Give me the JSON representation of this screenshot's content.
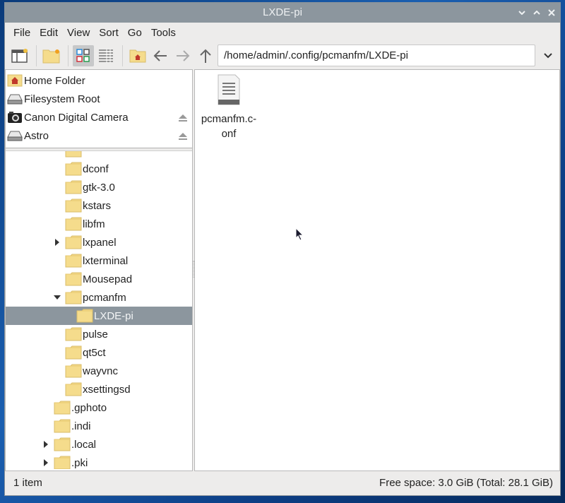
{
  "window": {
    "title": "LXDE-pi",
    "controls": [
      "minimize",
      "maximize",
      "close"
    ]
  },
  "menubar": {
    "items": [
      "File",
      "Edit",
      "View",
      "Sort",
      "Go",
      "Tools"
    ]
  },
  "toolbar": {
    "buttons": [
      {
        "name": "new-window",
        "icon": "new-window-icon"
      },
      {
        "name": "new-folder",
        "icon": "new-folder-icon"
      },
      {
        "name": "icon-view",
        "icon": "icon-view-icon",
        "active": true
      },
      {
        "name": "list-view",
        "icon": "list-view-icon"
      },
      {
        "name": "home",
        "icon": "home-folder-icon"
      },
      {
        "name": "back",
        "icon": "arrow-left-icon"
      },
      {
        "name": "forward",
        "icon": "arrow-right-icon",
        "disabled": true
      },
      {
        "name": "up",
        "icon": "arrow-up-icon"
      }
    ],
    "path": "/home/admin/.config/pcmanfm/LXDE-pi"
  },
  "places": [
    {
      "label": "Home Folder",
      "icon": "home-folder-icon",
      "eject": false
    },
    {
      "label": "Filesystem Root",
      "icon": "drive-icon",
      "eject": false
    },
    {
      "label": "Canon Digital Camera",
      "icon": "camera-icon",
      "eject": true
    },
    {
      "label": "Astro",
      "icon": "drive-icon",
      "eject": true
    }
  ],
  "tree": [
    {
      "label": "",
      "depth": 2,
      "expander": "none",
      "partial": true
    },
    {
      "label": "dconf",
      "depth": 2,
      "expander": "none"
    },
    {
      "label": "gtk-3.0",
      "depth": 2,
      "expander": "none"
    },
    {
      "label": "kstars",
      "depth": 2,
      "expander": "none"
    },
    {
      "label": "libfm",
      "depth": 2,
      "expander": "none"
    },
    {
      "label": "lxpanel",
      "depth": 2,
      "expander": "collapsed"
    },
    {
      "label": "lxterminal",
      "depth": 2,
      "expander": "none"
    },
    {
      "label": "Mousepad",
      "depth": 2,
      "expander": "none"
    },
    {
      "label": "pcmanfm",
      "depth": 2,
      "expander": "expanded"
    },
    {
      "label": "LXDE-pi",
      "depth": 3,
      "expander": "none",
      "selected": true
    },
    {
      "label": "pulse",
      "depth": 2,
      "expander": "none"
    },
    {
      "label": "qt5ct",
      "depth": 2,
      "expander": "none"
    },
    {
      "label": "wayvnc",
      "depth": 2,
      "expander": "none"
    },
    {
      "label": "xsettingsd",
      "depth": 2,
      "expander": "none"
    },
    {
      "label": ".gphoto",
      "depth": 1,
      "expander": "none"
    },
    {
      "label": ".indi",
      "depth": 1,
      "expander": "none"
    },
    {
      "label": ".local",
      "depth": 1,
      "expander": "collapsed"
    },
    {
      "label": ".pki",
      "depth": 1,
      "expander": "collapsed"
    },
    {
      "label": "",
      "depth": 1,
      "expander": "none",
      "partial": true
    }
  ],
  "files": [
    {
      "name": "pcmanfm.c-\nonf",
      "full_name": "pcmanfm.conf",
      "icon": "text-file-icon"
    }
  ],
  "statusbar": {
    "count": "1 item",
    "free_space": "Free space: 3.0 GiB (Total: 28.1 GiB)"
  },
  "colors": {
    "titlebar": "#8c969e",
    "selection": "#8c969e",
    "folder": "#f5dc8c",
    "window_bg": "#edeceb"
  }
}
